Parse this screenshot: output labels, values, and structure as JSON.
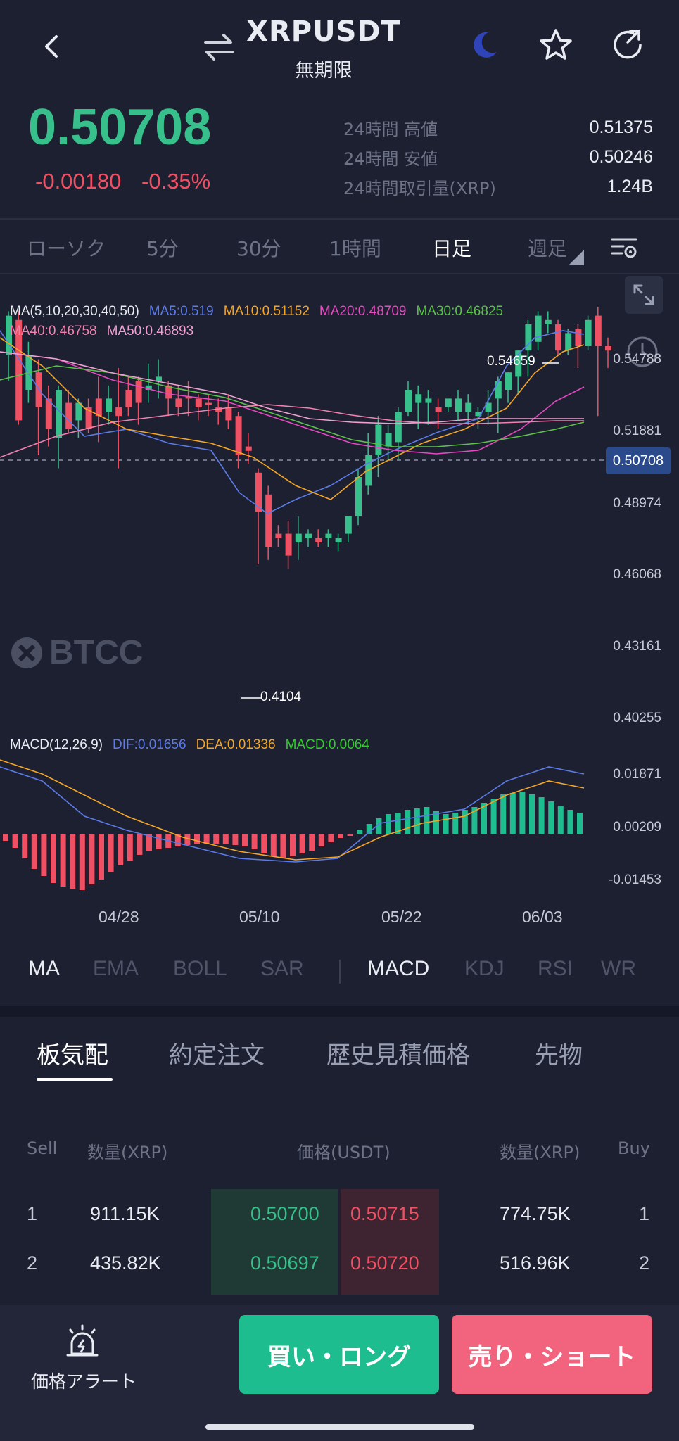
{
  "header": {
    "title": "XRPUSDT",
    "subtitle": "無期限"
  },
  "price": {
    "last": "0.50708",
    "change_abs": "-0.00180",
    "change_pct": "-0.35%"
  },
  "stats": [
    {
      "label": "24時間 高値",
      "value": "0.51375"
    },
    {
      "label": "24時間 安値",
      "value": "0.50246"
    },
    {
      "label": "24時間取引量(XRP)",
      "value": "1.24B"
    }
  ],
  "timeframes": [
    "ローソク",
    "5分",
    "30分",
    "1時間",
    "日足",
    "週足"
  ],
  "active_timeframe": "日足",
  "ma_legend": {
    "title": "MA(5,10,20,30,40,50)",
    "ma5": "MA5:0.519",
    "ma10": "MA10:0.51152",
    "ma20": "MA20:0.48709",
    "ma30": "MA30:0.46825",
    "ma40": "MA40:0.46758",
    "ma50": "MA50:0.46893"
  },
  "macd_legend": {
    "title": "MACD(12,26,9)",
    "dif": "DIF:0.01656",
    "dea": "DEA:0.01336",
    "macd": "MACD:0.0064"
  },
  "price_axis": [
    "0.54788",
    "0.51881",
    "0.48974",
    "0.46068",
    "0.43161",
    "0.40255"
  ],
  "macd_axis": [
    "0.01871",
    "0.00209",
    "-0.01453"
  ],
  "current_price_tag": "0.50708",
  "high_marker": "0.54659",
  "low_marker": "0.4104",
  "dates": [
    "04/28",
    "05/10",
    "05/22",
    "06/03"
  ],
  "watermark": "BTCC",
  "indicator_tabs": {
    "main": [
      "MA",
      "EMA",
      "BOLL",
      "SAR"
    ],
    "sub": [
      "MACD",
      "KDJ",
      "RSI",
      "WR"
    ],
    "active_main": "MA",
    "active_sub": "MACD"
  },
  "panel_tabs": [
    "板気配",
    "約定注文",
    "歴史見積価格",
    "先物"
  ],
  "orderbook": {
    "headers": {
      "sell": "Sell",
      "qty_left": "数量(XRP)",
      "price": "価格(USDT)",
      "qty_right": "数量(XRP)",
      "buy": "Buy"
    },
    "rows": [
      {
        "idx_left": "1",
        "qty_left": "911.15K",
        "bid": "0.50700",
        "ask": "0.50715",
        "qty_right": "774.75K",
        "idx_right": "1"
      },
      {
        "idx_left": "2",
        "qty_left": "435.82K",
        "bid": "0.50697",
        "ask": "0.50720",
        "qty_right": "516.96K",
        "idx_right": "2"
      }
    ]
  },
  "actions": {
    "alert_label": "価格アラート",
    "buy_label": "買い・ロング",
    "sell_label": "売り・ショート"
  },
  "colors": {
    "up": "#37c08b",
    "down": "#ef5063",
    "ma5": "#5b7be8",
    "ma10": "#f5a623",
    "ma20": "#e64ac0",
    "ma30": "#5cc24a",
    "ma40": "#f281b0",
    "ma50": "#f0a0d0"
  }
}
